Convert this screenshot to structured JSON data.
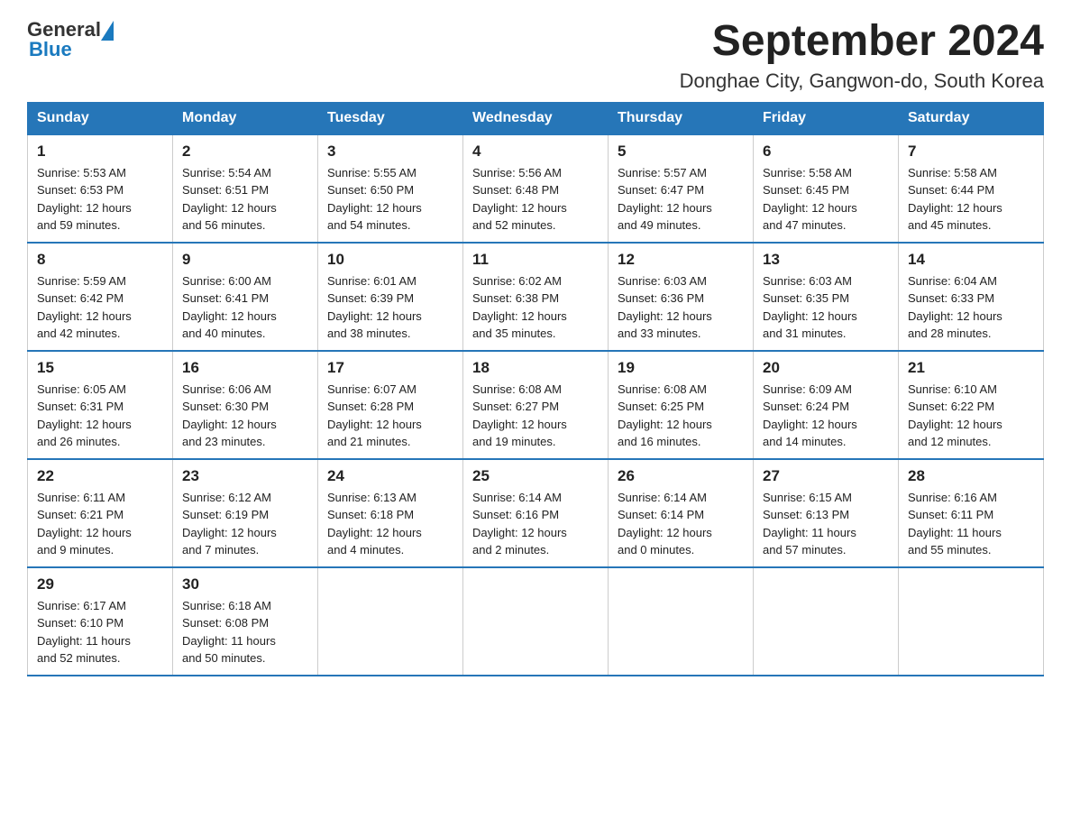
{
  "header": {
    "logo_general": "General",
    "logo_blue": "Blue",
    "title": "September 2024",
    "subtitle": "Donghae City, Gangwon-do, South Korea"
  },
  "days_of_week": [
    "Sunday",
    "Monday",
    "Tuesday",
    "Wednesday",
    "Thursday",
    "Friday",
    "Saturday"
  ],
  "weeks": [
    [
      {
        "day": "1",
        "sunrise": "5:53 AM",
        "sunset": "6:53 PM",
        "daylight": "12 hours and 59 minutes."
      },
      {
        "day": "2",
        "sunrise": "5:54 AM",
        "sunset": "6:51 PM",
        "daylight": "12 hours and 56 minutes."
      },
      {
        "day": "3",
        "sunrise": "5:55 AM",
        "sunset": "6:50 PM",
        "daylight": "12 hours and 54 minutes."
      },
      {
        "day": "4",
        "sunrise": "5:56 AM",
        "sunset": "6:48 PM",
        "daylight": "12 hours and 52 minutes."
      },
      {
        "day": "5",
        "sunrise": "5:57 AM",
        "sunset": "6:47 PM",
        "daylight": "12 hours and 49 minutes."
      },
      {
        "day": "6",
        "sunrise": "5:58 AM",
        "sunset": "6:45 PM",
        "daylight": "12 hours and 47 minutes."
      },
      {
        "day": "7",
        "sunrise": "5:58 AM",
        "sunset": "6:44 PM",
        "daylight": "12 hours and 45 minutes."
      }
    ],
    [
      {
        "day": "8",
        "sunrise": "5:59 AM",
        "sunset": "6:42 PM",
        "daylight": "12 hours and 42 minutes."
      },
      {
        "day": "9",
        "sunrise": "6:00 AM",
        "sunset": "6:41 PM",
        "daylight": "12 hours and 40 minutes."
      },
      {
        "day": "10",
        "sunrise": "6:01 AM",
        "sunset": "6:39 PM",
        "daylight": "12 hours and 38 minutes."
      },
      {
        "day": "11",
        "sunrise": "6:02 AM",
        "sunset": "6:38 PM",
        "daylight": "12 hours and 35 minutes."
      },
      {
        "day": "12",
        "sunrise": "6:03 AM",
        "sunset": "6:36 PM",
        "daylight": "12 hours and 33 minutes."
      },
      {
        "day": "13",
        "sunrise": "6:03 AM",
        "sunset": "6:35 PM",
        "daylight": "12 hours and 31 minutes."
      },
      {
        "day": "14",
        "sunrise": "6:04 AM",
        "sunset": "6:33 PM",
        "daylight": "12 hours and 28 minutes."
      }
    ],
    [
      {
        "day": "15",
        "sunrise": "6:05 AM",
        "sunset": "6:31 PM",
        "daylight": "12 hours and 26 minutes."
      },
      {
        "day": "16",
        "sunrise": "6:06 AM",
        "sunset": "6:30 PM",
        "daylight": "12 hours and 23 minutes."
      },
      {
        "day": "17",
        "sunrise": "6:07 AM",
        "sunset": "6:28 PM",
        "daylight": "12 hours and 21 minutes."
      },
      {
        "day": "18",
        "sunrise": "6:08 AM",
        "sunset": "6:27 PM",
        "daylight": "12 hours and 19 minutes."
      },
      {
        "day": "19",
        "sunrise": "6:08 AM",
        "sunset": "6:25 PM",
        "daylight": "12 hours and 16 minutes."
      },
      {
        "day": "20",
        "sunrise": "6:09 AM",
        "sunset": "6:24 PM",
        "daylight": "12 hours and 14 minutes."
      },
      {
        "day": "21",
        "sunrise": "6:10 AM",
        "sunset": "6:22 PM",
        "daylight": "12 hours and 12 minutes."
      }
    ],
    [
      {
        "day": "22",
        "sunrise": "6:11 AM",
        "sunset": "6:21 PM",
        "daylight": "12 hours and 9 minutes."
      },
      {
        "day": "23",
        "sunrise": "6:12 AM",
        "sunset": "6:19 PM",
        "daylight": "12 hours and 7 minutes."
      },
      {
        "day": "24",
        "sunrise": "6:13 AM",
        "sunset": "6:18 PM",
        "daylight": "12 hours and 4 minutes."
      },
      {
        "day": "25",
        "sunrise": "6:14 AM",
        "sunset": "6:16 PM",
        "daylight": "12 hours and 2 minutes."
      },
      {
        "day": "26",
        "sunrise": "6:14 AM",
        "sunset": "6:14 PM",
        "daylight": "12 hours and 0 minutes."
      },
      {
        "day": "27",
        "sunrise": "6:15 AM",
        "sunset": "6:13 PM",
        "daylight": "11 hours and 57 minutes."
      },
      {
        "day": "28",
        "sunrise": "6:16 AM",
        "sunset": "6:11 PM",
        "daylight": "11 hours and 55 minutes."
      }
    ],
    [
      {
        "day": "29",
        "sunrise": "6:17 AM",
        "sunset": "6:10 PM",
        "daylight": "11 hours and 52 minutes."
      },
      {
        "day": "30",
        "sunrise": "6:18 AM",
        "sunset": "6:08 PM",
        "daylight": "11 hours and 50 minutes."
      },
      null,
      null,
      null,
      null,
      null
    ]
  ]
}
